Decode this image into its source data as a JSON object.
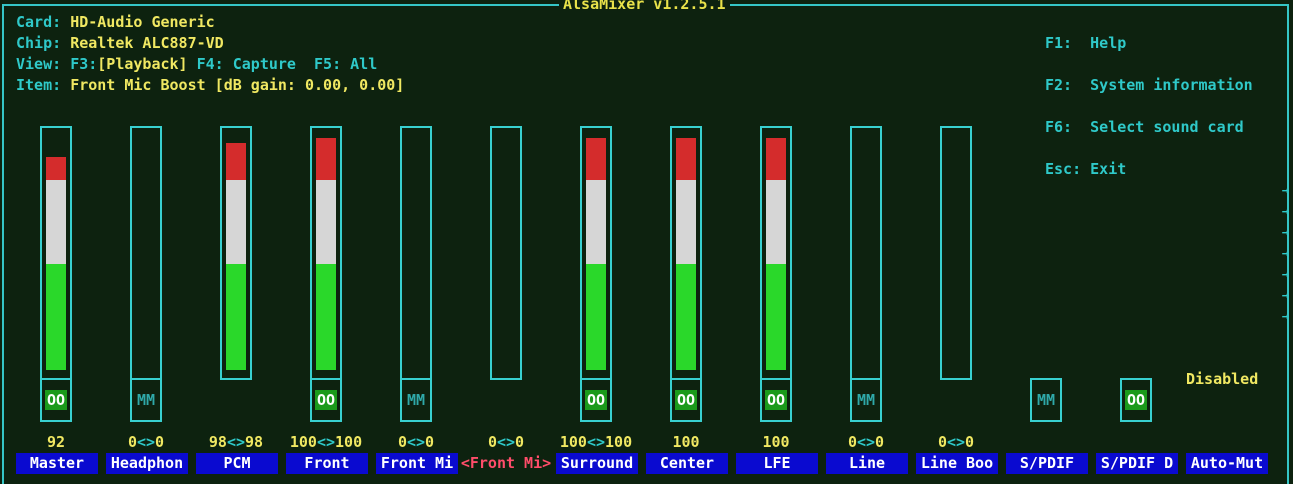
{
  "window": {
    "title": "AlsaMixer v1.2.5.1"
  },
  "info": {
    "card_label": "Card:",
    "card_value": "HD-Audio Generic",
    "chip_label": "Chip:",
    "chip_value": "Realtek ALC887-VD",
    "view_label": "View:",
    "view_f3": "F3:",
    "view_playback": "[Playback]",
    "view_f4": "F4: Capture",
    "view_f5": "F5: All",
    "item_label": "Item:",
    "item_value": "Front Mic Boost [dB gain: 0.00, 0.00]"
  },
  "help": {
    "f1": "F1:",
    "f1_text": "Help",
    "f2": "F2:",
    "f2_text": "System information",
    "f6": "F6:",
    "f6_text": "Select sound card",
    "esc": "Esc:",
    "esc_text": "Exit"
  },
  "status": {
    "disabled": "Disabled"
  },
  "scroll_arrows": [
    "→",
    "→",
    "→",
    "→",
    "→",
    "→",
    "→"
  ],
  "channels": [
    {
      "label": "Master",
      "value": "92",
      "switch": "OO",
      "level": 0.92
    },
    {
      "label": "Headphon",
      "value": "0<>0",
      "switch": "MM",
      "level": 0
    },
    {
      "label": "PCM",
      "value": "98<>98",
      "switch": "",
      "level": 0.98
    },
    {
      "label": "Front",
      "value": "100<>100",
      "switch": "OO",
      "level": 1.0
    },
    {
      "label": "Front Mi",
      "value": "0<>0",
      "switch": "MM",
      "level": 0
    },
    {
      "label": "<Front Mi>",
      "value": "0<>0",
      "switch": "",
      "level": 0
    },
    {
      "label": "Surround",
      "value": "100<>100",
      "switch": "OO",
      "level": 1.0
    },
    {
      "label": "Center",
      "value": "100",
      "switch": "OO",
      "level": 1.0
    },
    {
      "label": "LFE",
      "value": "100",
      "switch": "OO",
      "level": 1.0
    },
    {
      "label": "Line",
      "value": "0<>0",
      "switch": "MM",
      "level": 0
    },
    {
      "label": "Line Boo",
      "value": "0<>0",
      "switch": "",
      "level": 0
    },
    {
      "label": "S/PDIF",
      "value": "",
      "switch": "MM",
      "level": null
    },
    {
      "label": "S/PDIF D",
      "value": "",
      "switch": "OO",
      "level": null
    },
    {
      "label": "Auto-Mut",
      "value": "",
      "switch": "",
      "level": null
    }
  ]
}
